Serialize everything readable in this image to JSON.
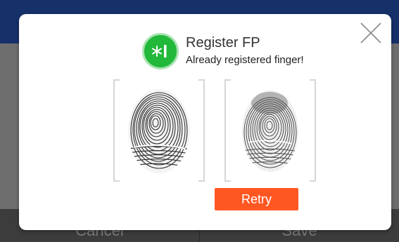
{
  "background": {
    "bottom_buttons": [
      "Cancel",
      "Save"
    ]
  },
  "dialog": {
    "title": "Register FP",
    "subtitle": "Already registered finger!",
    "close_icon": "close-icon",
    "app_icon": "fingerprint-app-icon",
    "retry_label": "Retry"
  },
  "colors": {
    "header_bar": "#16306a",
    "icon_green": "#22b83a",
    "retry_orange": "#ff5722"
  }
}
